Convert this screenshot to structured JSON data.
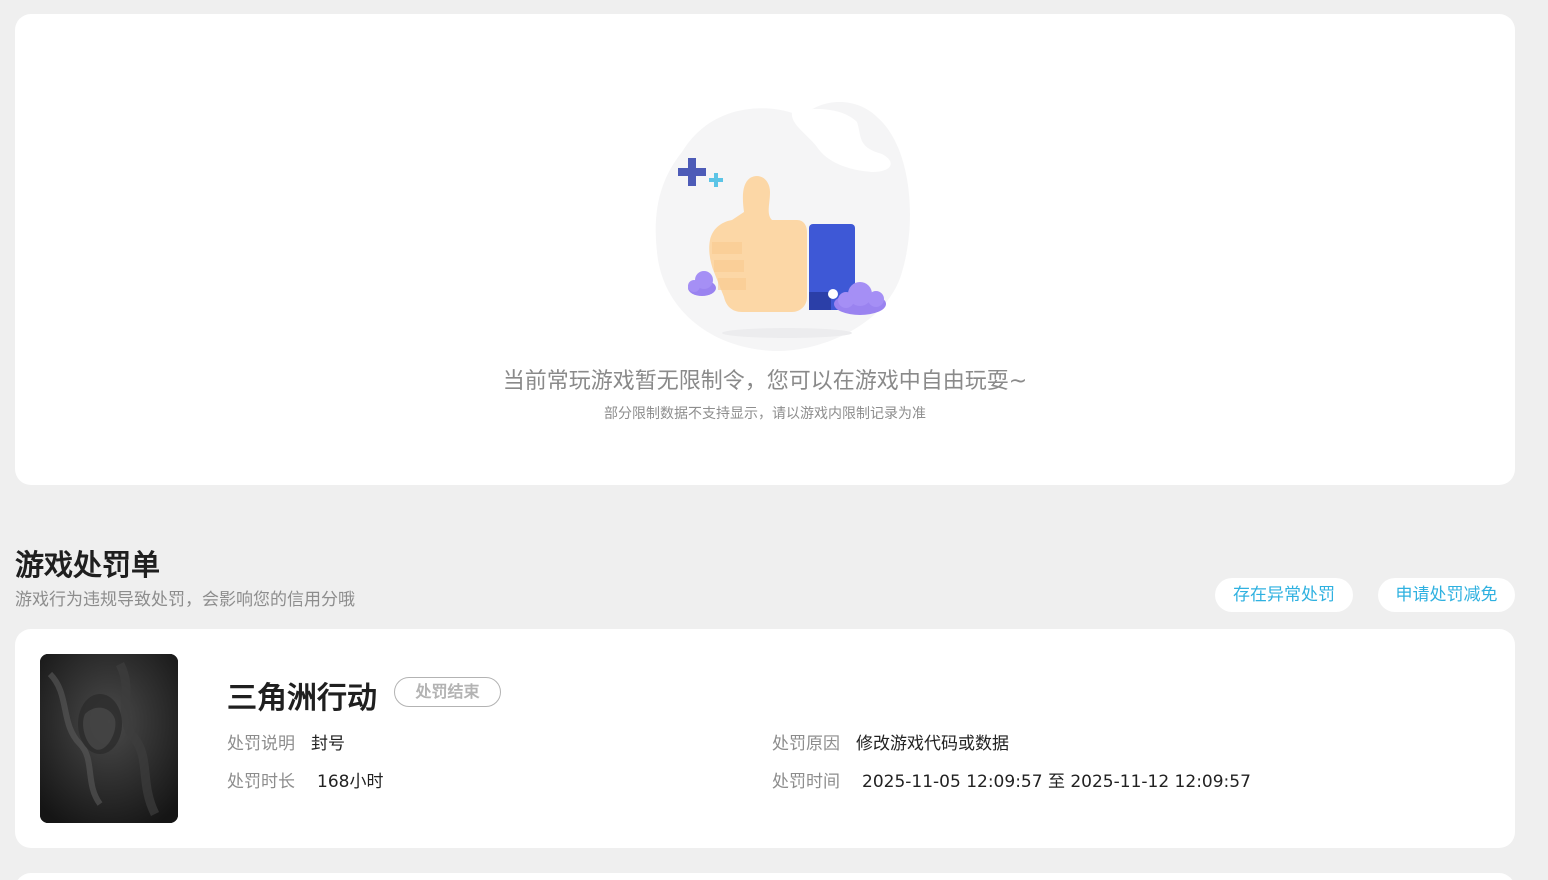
{
  "empty_state": {
    "title": "当前常玩游戏暂无限制令，您可以在游戏中自由玩耍~",
    "subtitle": "部分限制数据不支持显示，请以游戏内限制记录为准",
    "illustration_icon": "thumbs-up-illustration"
  },
  "section": {
    "title": "游戏处罚单",
    "description": "游戏行为违规导致处罚，会影响您的信用分哦",
    "abnormal_button": "存在异常处罚",
    "appeal_button": "申请处罚减免"
  },
  "penalty": {
    "game_name": "三角洲行动",
    "status": "处罚结束",
    "desc_label": "处罚说明",
    "desc_value": "封号",
    "duration_label": "处罚时长",
    "duration_value": "168小时",
    "reason_label": "处罚原因",
    "reason_value": "修改游戏代码或数据",
    "time_label": "处罚时间",
    "time_value": "2025-11-05 12:09:57 至 2025-11-12 12:09:57"
  },
  "colors": {
    "accent": "#2fb1e0",
    "background": "#efefef",
    "card": "#ffffff"
  }
}
